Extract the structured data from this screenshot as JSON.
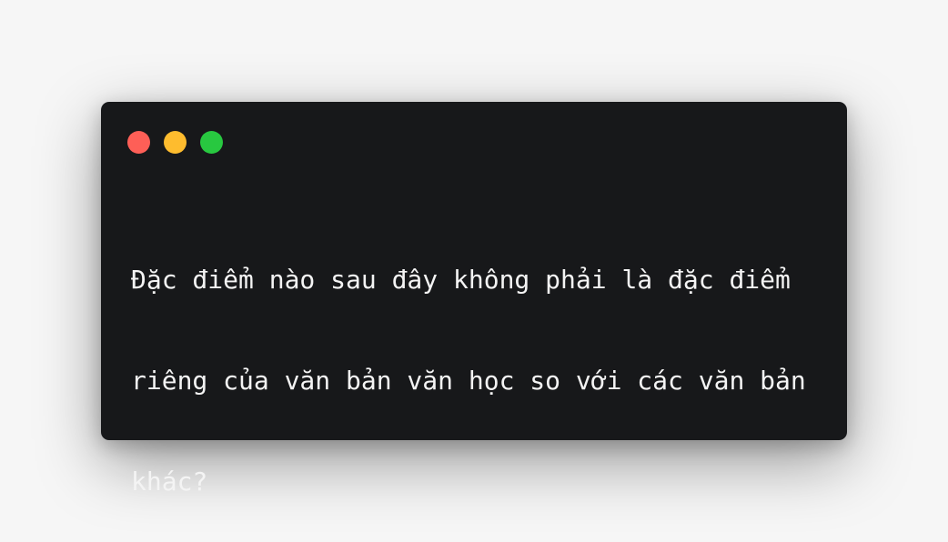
{
  "window": {
    "background": "#17181a",
    "controls": [
      {
        "name": "close",
        "color": "#fe5f57"
      },
      {
        "name": "minimize",
        "color": "#febc2e"
      },
      {
        "name": "maximize",
        "color": "#28c840"
      }
    ],
    "lines": [
      "Đặc điểm nào sau đây không phải là đặc điểm",
      "riêng của văn bản văn học so với các văn bản",
      "khác?"
    ]
  }
}
